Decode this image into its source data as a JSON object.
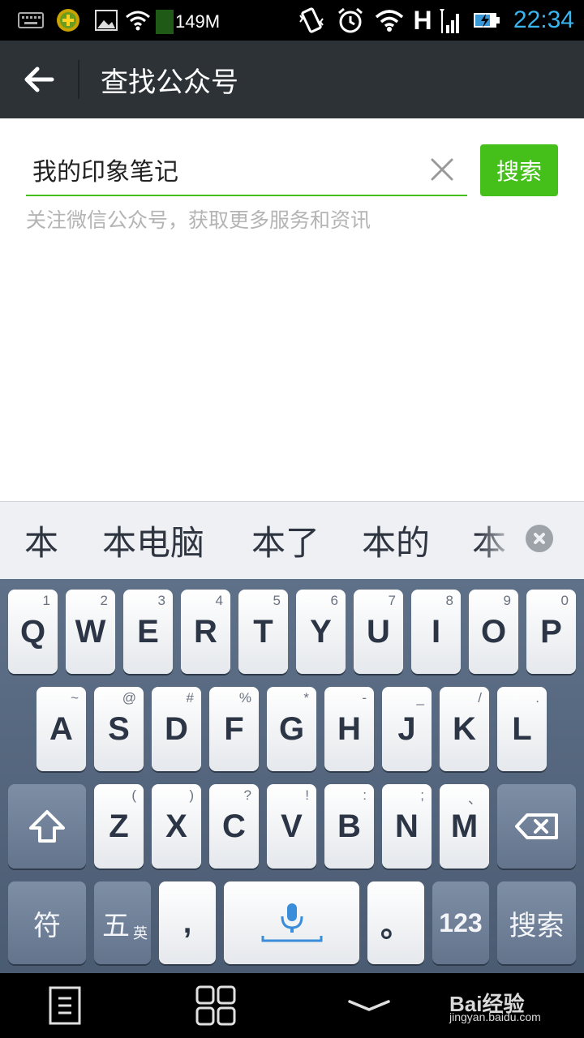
{
  "status_bar": {
    "memory": "149M",
    "network": "H",
    "time": "22:34",
    "time_color": "#39b5ef",
    "icons": [
      "keyboard-icon",
      "app-notification-icon",
      "image-icon",
      "wifi-icon",
      "vibrate-icon",
      "alarm-icon",
      "wifi-icon",
      "signal-icon",
      "battery-charging-icon"
    ]
  },
  "app_bar": {
    "title": "查找公众号",
    "back_icon": "arrow-left-icon"
  },
  "search": {
    "value": "我的印象笔记",
    "button_label": "搜索",
    "hint": "关注微信公众号，获取更多服务和资讯",
    "accent": "#45c01a"
  },
  "candidates": [
    "本",
    "本电脑",
    "本了",
    "本的",
    "本"
  ],
  "keyboard": {
    "row1": [
      {
        "k": "Q",
        "s": "1"
      },
      {
        "k": "W",
        "s": "2"
      },
      {
        "k": "E",
        "s": "3"
      },
      {
        "k": "R",
        "s": "4"
      },
      {
        "k": "T",
        "s": "5"
      },
      {
        "k": "Y",
        "s": "6"
      },
      {
        "k": "U",
        "s": "7"
      },
      {
        "k": "I",
        "s": "8"
      },
      {
        "k": "O",
        "s": "9"
      },
      {
        "k": "P",
        "s": "0"
      }
    ],
    "row2": [
      {
        "k": "A",
        "s": "~"
      },
      {
        "k": "S",
        "s": "@"
      },
      {
        "k": "D",
        "s": "#"
      },
      {
        "k": "F",
        "s": "%"
      },
      {
        "k": "G",
        "s": "*"
      },
      {
        "k": "H",
        "s": "-"
      },
      {
        "k": "J",
        "s": "_"
      },
      {
        "k": "K",
        "s": "/"
      },
      {
        "k": "L",
        "s": "."
      }
    ],
    "row3": [
      {
        "k": "Z",
        "s": "("
      },
      {
        "k": "X",
        "s": ")"
      },
      {
        "k": "C",
        "s": "?"
      },
      {
        "k": "V",
        "s": "!"
      },
      {
        "k": "B",
        "s": ":"
      },
      {
        "k": "N",
        "s": ";"
      },
      {
        "k": "M",
        "s": "、"
      }
    ],
    "symbols_key": "符",
    "wubi_key": "五",
    "wubi_sub": "英",
    "comma_key": ",",
    "period_key": "。",
    "num_key": "123",
    "search_key": "搜索"
  },
  "watermark": {
    "brand": "Bai经验",
    "url": "jingyan.baidu.com"
  }
}
